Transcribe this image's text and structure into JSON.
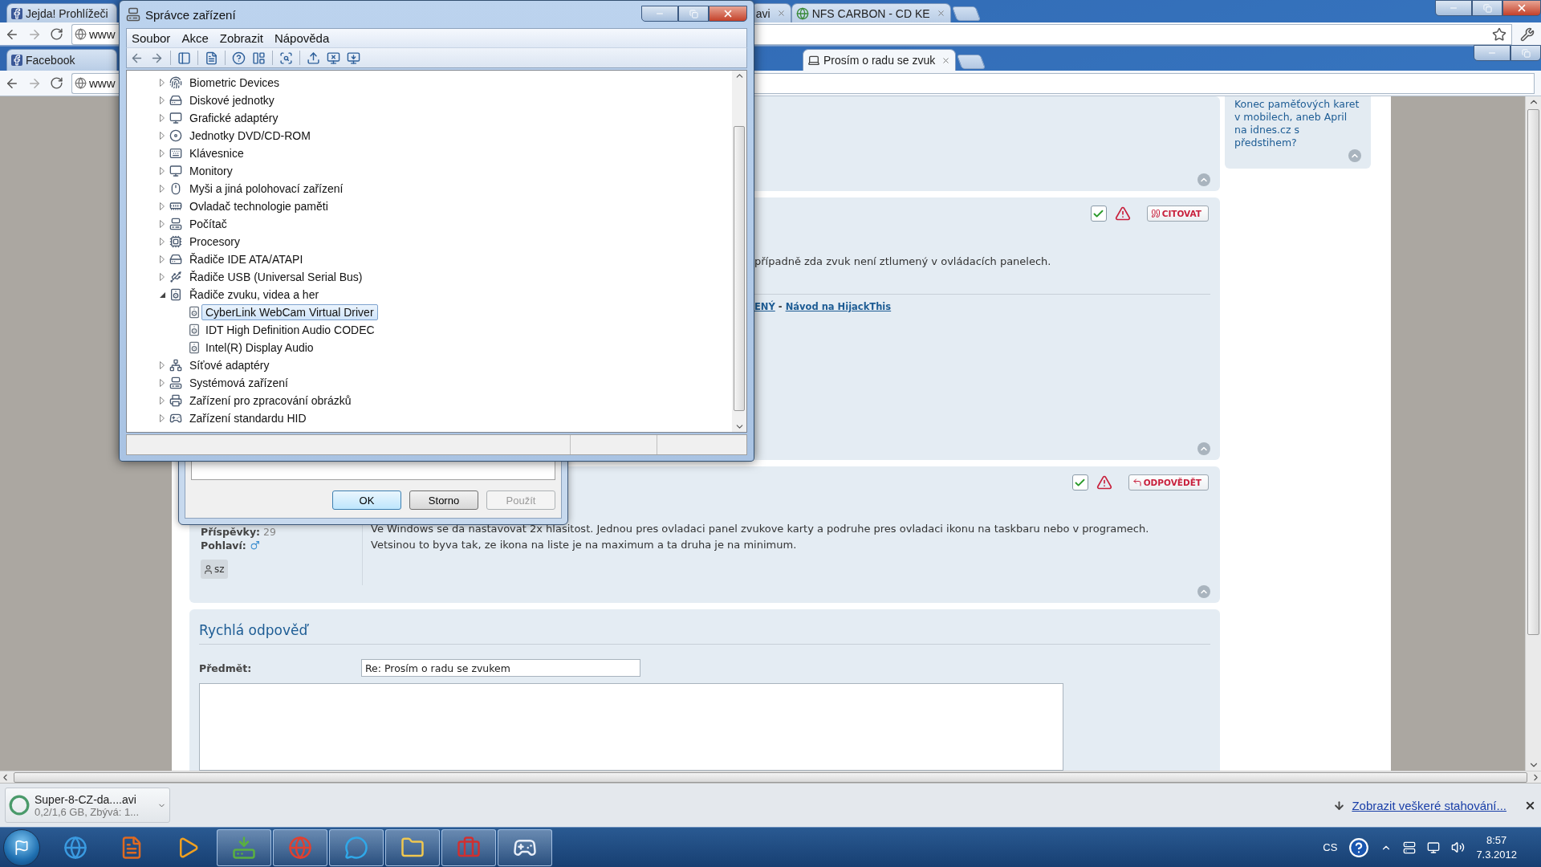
{
  "back_browser": {
    "tabs": [
      {
        "title": "Jejda! Prohlížeči",
        "selected": false
      },
      {
        "title": "avi",
        "selected": false
      },
      {
        "title": "NFS CARBON - CD KE",
        "selected": false
      }
    ],
    "address": "www"
  },
  "front_browser": {
    "tabs": [
      {
        "title": "Facebook",
        "selected": false
      },
      {
        "title": "Prosím o radu se zvuk",
        "selected": true
      }
    ],
    "address": "www",
    "sidebar_box": {
      "text": "Konec paměťových karet v mobilech, aneb April na idnes.cz s předstihem?"
    },
    "posts": [
      {
        "kind": "hidden"
      },
      {
        "kind": "cut",
        "action": {
          "label": "CITOVAT",
          "kind": "quote"
        },
        "text": "případně zda zvuk není ztlumený v ovládacích panelech.",
        "signature": {
          "links": [
            "ENÝ",
            "Návod na HijackThis"
          ],
          "separator": "-"
        }
      },
      {
        "kind": "full",
        "action": {
          "label": "ODPOVĚDĚT",
          "kind": "reply"
        },
        "posts_label": "Příspěvky:",
        "posts_count": "29",
        "gender_label": "Pohlaví:",
        "badge": "sz",
        "text": "Ve Windows se da nastavovat 2x hlasitost. Jednou pres ovladaci panel zvukove karty a podruhe pres ovladaci ikonu na taskbaru nebo v programech. Vetsinou to byva tak, ze ikona na liste je na maximum a ta druha je na minimum."
      }
    ],
    "quick_reply": {
      "title": "Rychlá odpověď",
      "subject_label": "Předmět:",
      "subject_value": "Re: Prosím o radu se zvukem"
    }
  },
  "download_bar": {
    "file": "Super-8-CZ-da....avi",
    "status": "0,2/1,6 GB, Zbývá: 1...",
    "show_all": "Zobrazit veškeré stahování..."
  },
  "dialog": {
    "buttons": [
      {
        "label": "OK",
        "default": true,
        "disabled": false
      },
      {
        "label": "Storno",
        "default": false,
        "disabled": false
      },
      {
        "label": "Použít",
        "default": false,
        "disabled": true
      }
    ]
  },
  "device_manager": {
    "title": "Správce zařízení",
    "menu": [
      "Soubor",
      "Akce",
      "Zobrazit",
      "Nápověda"
    ],
    "tree": [
      {
        "label": "Biometric Devices",
        "expanded": false,
        "selected": false
      },
      {
        "label": "Diskové jednotky",
        "expanded": false,
        "selected": false
      },
      {
        "label": "Grafické adaptéry",
        "expanded": false,
        "selected": false
      },
      {
        "label": "Jednotky DVD/CD-ROM",
        "expanded": false,
        "selected": false
      },
      {
        "label": "Klávesnice",
        "expanded": false,
        "selected": false
      },
      {
        "label": "Monitory",
        "expanded": false,
        "selected": false
      },
      {
        "label": "Myši a jiná polohovací zařízení",
        "expanded": false,
        "selected": false
      },
      {
        "label": "Ovladač technologie paměti",
        "expanded": false,
        "selected": false
      },
      {
        "label": "Počítač",
        "expanded": false,
        "selected": false
      },
      {
        "label": "Procesory",
        "expanded": false,
        "selected": false
      },
      {
        "label": "Řadiče IDE ATA/ATAPI",
        "expanded": false,
        "selected": false
      },
      {
        "label": "Řadiče USB (Universal Serial Bus)",
        "expanded": false,
        "selected": false
      },
      {
        "label": "Řadiče zvuku, videa a her",
        "expanded": true,
        "selected": false,
        "children": [
          {
            "label": "CyberLink WebCam Virtual Driver",
            "selected": true
          },
          {
            "label": "IDT High Definition Audio CODEC",
            "selected": false
          },
          {
            "label": "Intel(R) Display Audio",
            "selected": false
          }
        ]
      },
      {
        "label": "Síťové adaptéry",
        "expanded": false,
        "selected": false
      },
      {
        "label": "Systémová zařízení",
        "expanded": false,
        "selected": false
      },
      {
        "label": "Zařízení pro zpracování obrázků",
        "expanded": false,
        "selected": false
      },
      {
        "label": "Zařízení standardu HID",
        "expanded": false,
        "selected": false
      }
    ]
  },
  "taskbar": {
    "buttons": [
      {
        "running": false
      },
      {
        "running": false
      },
      {
        "running": false
      },
      {
        "running": true
      },
      {
        "running": true
      },
      {
        "running": true
      },
      {
        "running": true
      },
      {
        "running": true
      },
      {
        "running": true
      }
    ],
    "language": "CS",
    "time": "8:57",
    "date": "7.3.2012"
  }
}
